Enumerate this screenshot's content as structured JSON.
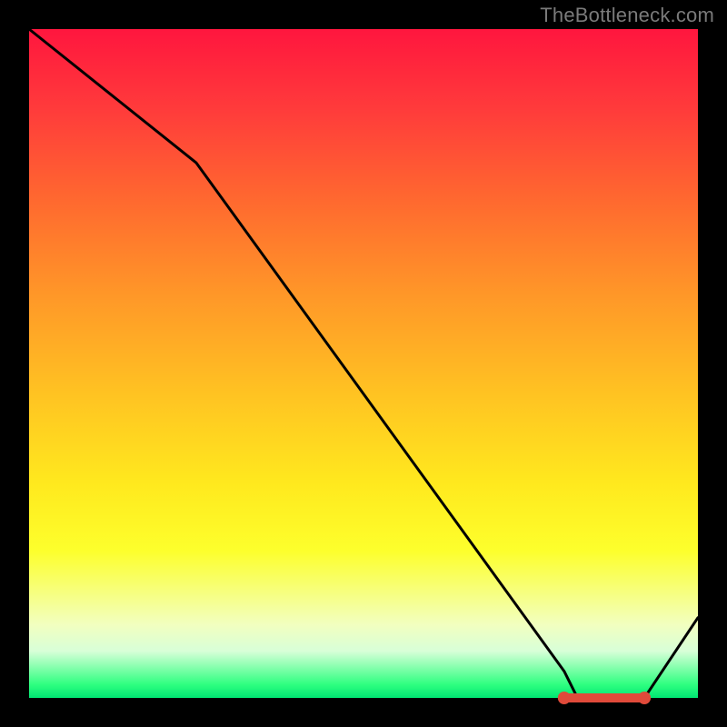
{
  "attribution": "TheBottleneck.com",
  "chart_data": {
    "type": "line",
    "title": "",
    "xlabel": "",
    "ylabel": "",
    "ylim": [
      0,
      100
    ],
    "x": [
      0,
      25,
      80,
      82,
      92,
      100
    ],
    "values": [
      100,
      80,
      4,
      0,
      0,
      12
    ],
    "marker_cluster": {
      "x_range": [
        80,
        92
      ],
      "y": 0,
      "color": "#e04a3a"
    }
  },
  "colors": {
    "line": "#000000",
    "marker": "#e04a3a",
    "frame": "#000000"
  }
}
